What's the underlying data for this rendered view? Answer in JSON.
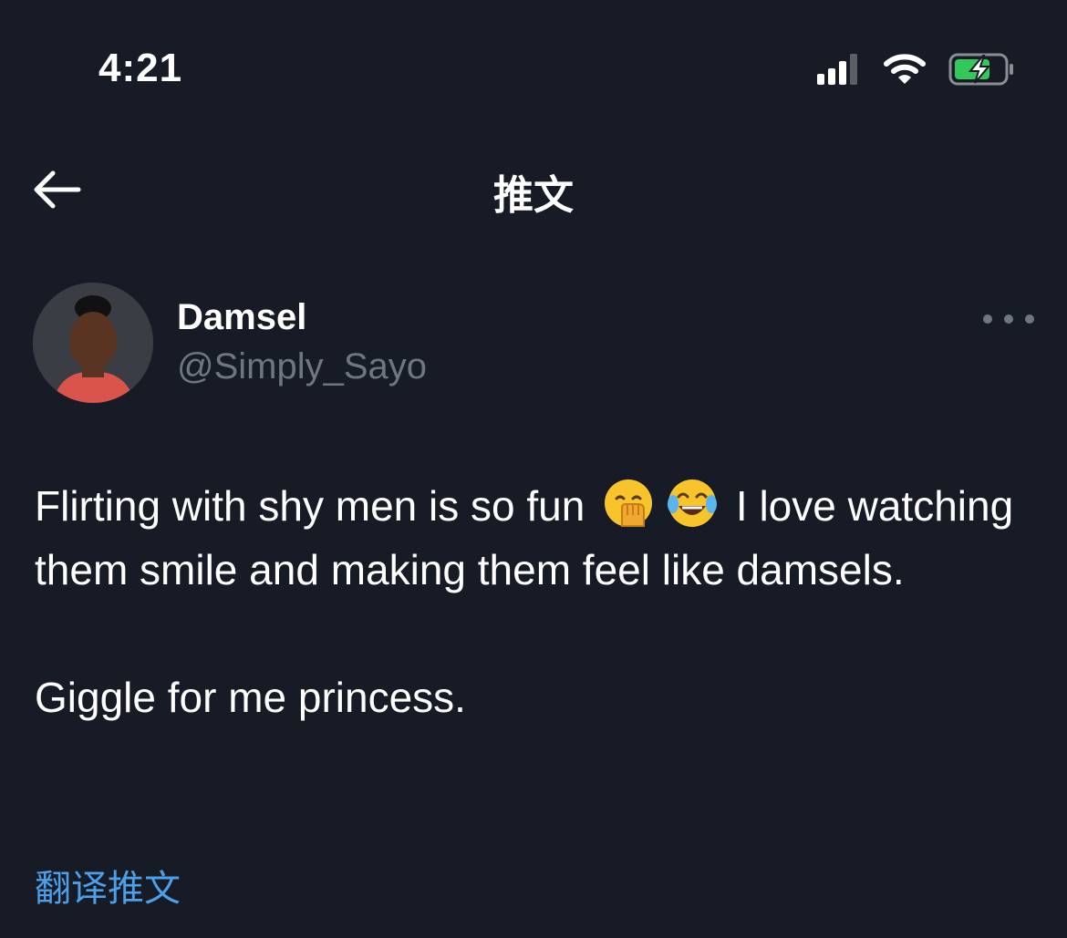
{
  "status_bar": {
    "time": "4:21",
    "icons": [
      "cellular-signal-icon",
      "wifi-icon",
      "battery-charging-icon"
    ]
  },
  "nav": {
    "back_icon": "arrow-left-icon",
    "title": "推文"
  },
  "tweet": {
    "author": {
      "display_name": "Damsel",
      "handle": "@Simply_Sayo"
    },
    "more_icon": "more-horizontal-icon",
    "text_line1_a": "Flirting with shy men is so fun",
    "emoji_1": "face-with-hand-over-mouth",
    "emoji_2": "face-with-tears-of-joy",
    "text_line1_b": "I love watching them smile and making them feel like damsels.",
    "text_para2": "Giggle for me princess.",
    "translate_label": "翻译推文"
  },
  "colors": {
    "background": "#161b26",
    "text_primary": "#ffffff",
    "text_secondary": "#6e7781",
    "link": "#4c9fe8",
    "battery_green": "#34c759"
  }
}
